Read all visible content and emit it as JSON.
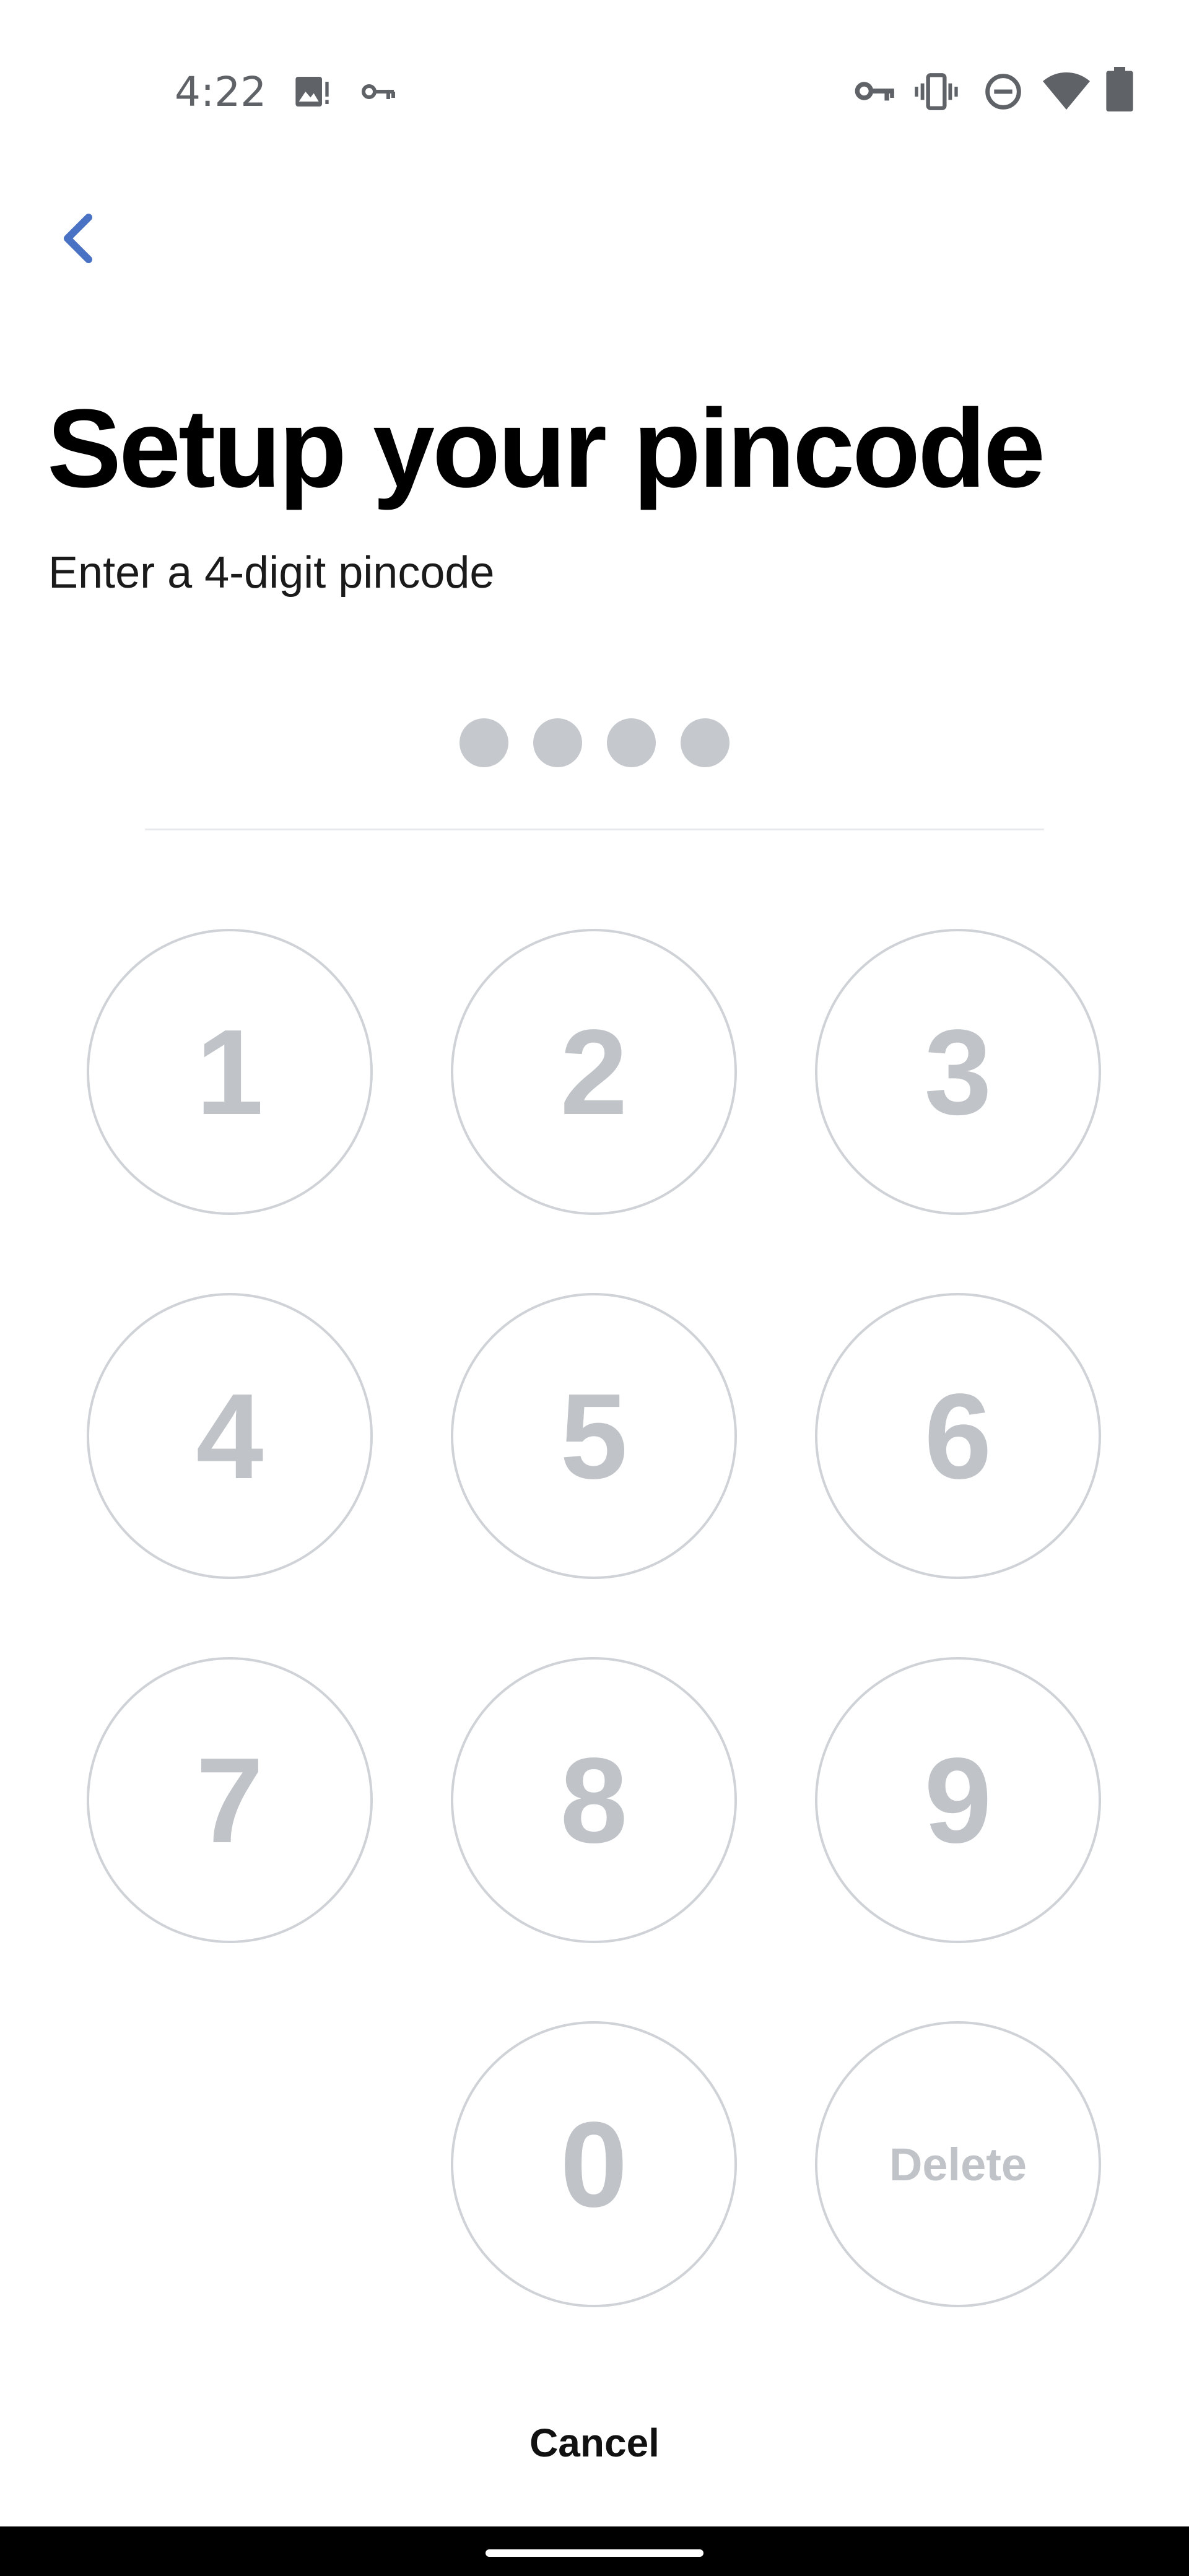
{
  "status_bar": {
    "time": "4:22",
    "left_icons": [
      "image-alert-icon",
      "key-icon"
    ],
    "right_icons": [
      "vpn-key-icon",
      "vibrate-icon",
      "do-not-disturb-icon",
      "wifi-icon",
      "battery-icon"
    ]
  },
  "header": {
    "back_icon": "chevron-left-icon",
    "title": "Setup your pincode",
    "subtitle": "Enter a 4-digit pincode"
  },
  "pin": {
    "length": 4,
    "entered": 0
  },
  "keypad": {
    "keys": [
      "1",
      "2",
      "3",
      "4",
      "5",
      "6",
      "7",
      "8",
      "9",
      "0"
    ],
    "delete_label": "Delete"
  },
  "footer": {
    "cancel_label": "Cancel"
  },
  "colors": {
    "accent": "#4a72c4",
    "key_border": "#cfd2d6",
    "key_text": "#c0c4c9",
    "pin_dot": "#c5c9ce"
  }
}
